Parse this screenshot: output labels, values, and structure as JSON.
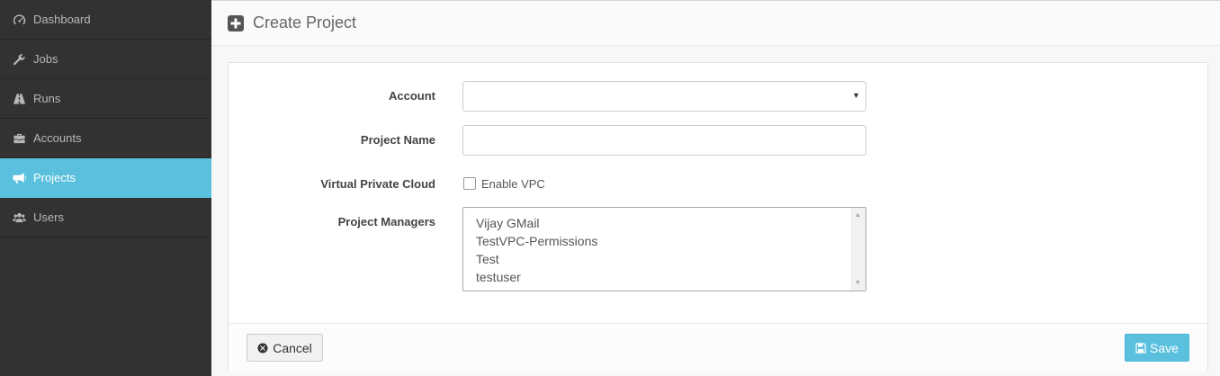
{
  "sidebar": {
    "items": [
      {
        "label": "Dashboard",
        "icon": "dashboard-icon",
        "active": false
      },
      {
        "label": "Jobs",
        "icon": "wrench-icon",
        "active": false
      },
      {
        "label": "Runs",
        "icon": "road-icon",
        "active": false
      },
      {
        "label": "Accounts",
        "icon": "briefcase-icon",
        "active": false
      },
      {
        "label": "Projects",
        "icon": "bullhorn-icon",
        "active": true
      },
      {
        "label": "Users",
        "icon": "users-icon",
        "active": false
      }
    ],
    "active_color": "#5bc0de"
  },
  "header": {
    "title": "Create Project",
    "icon": "plus-square-icon"
  },
  "form": {
    "account": {
      "label": "Account",
      "value": ""
    },
    "project_name": {
      "label": "Project Name",
      "value": ""
    },
    "vpc": {
      "label": "Virtual Private Cloud",
      "checkbox_label": "Enable VPC",
      "checked": false
    },
    "managers": {
      "label": "Project Managers",
      "options": [
        "Vijay GMail",
        "TestVPC-Permissions",
        "Test",
        "testuser"
      ]
    }
  },
  "footer": {
    "cancel_label": "Cancel",
    "cancel_icon": "times-circle-icon",
    "save_label": "Save",
    "save_icon": "save-icon",
    "save_color": "#5bc0de"
  }
}
